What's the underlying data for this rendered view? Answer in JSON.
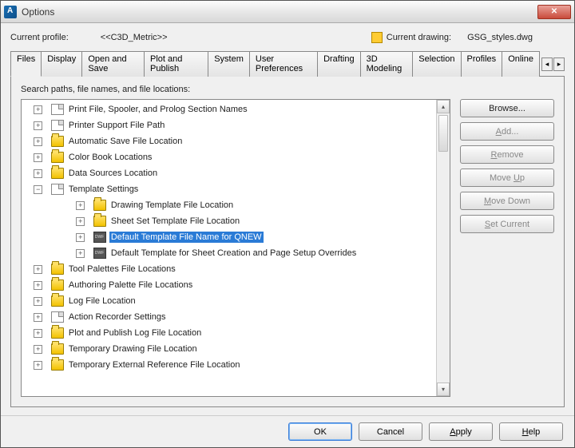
{
  "window": {
    "title": "Options"
  },
  "profile": {
    "label": "Current profile:",
    "value": "<<C3D_Metric>>",
    "drawing_label": "Current drawing:",
    "drawing_value": "GSG_styles.dwg"
  },
  "tabs": {
    "items": [
      "Files",
      "Display",
      "Open and Save",
      "Plot and Publish",
      "System",
      "User Preferences",
      "Drafting",
      "3D Modeling",
      "Selection",
      "Profiles",
      "Online"
    ],
    "active_index": 0
  },
  "panel": {
    "label": "Search paths, file names, and file locations:"
  },
  "tree": {
    "nodes": [
      {
        "indent": 0,
        "exp": "+",
        "icon": "doc",
        "label": "Print File, Spooler, and Prolog Section Names"
      },
      {
        "indent": 0,
        "exp": "+",
        "icon": "doc",
        "label": "Printer Support File Path"
      },
      {
        "indent": 0,
        "exp": "+",
        "icon": "folder",
        "label": "Automatic Save File Location"
      },
      {
        "indent": 0,
        "exp": "+",
        "icon": "folder",
        "label": "Color Book Locations"
      },
      {
        "indent": 0,
        "exp": "+",
        "icon": "folder",
        "label": "Data Sources Location"
      },
      {
        "indent": 0,
        "exp": "-",
        "icon": "doc",
        "label": "Template Settings"
      },
      {
        "indent": 1,
        "exp": "+",
        "icon": "folder",
        "label": "Drawing Template File Location"
      },
      {
        "indent": 1,
        "exp": "+",
        "icon": "folder",
        "label": "Sheet Set Template File Location"
      },
      {
        "indent": 1,
        "exp": "+",
        "icon": "dwf",
        "label": "Default Template File Name for QNEW",
        "selected": true
      },
      {
        "indent": 1,
        "exp": "+",
        "icon": "dwf",
        "label": "Default Template for Sheet Creation and Page Setup Overrides"
      },
      {
        "indent": 0,
        "exp": "+",
        "icon": "folder",
        "label": "Tool Palettes File Locations"
      },
      {
        "indent": 0,
        "exp": "+",
        "icon": "folder",
        "label": "Authoring Palette File Locations"
      },
      {
        "indent": 0,
        "exp": "+",
        "icon": "folder",
        "label": "Log File Location"
      },
      {
        "indent": 0,
        "exp": "+",
        "icon": "doc",
        "label": "Action Recorder Settings"
      },
      {
        "indent": 0,
        "exp": "+",
        "icon": "folder",
        "label": "Plot and Publish Log File Location"
      },
      {
        "indent": 0,
        "exp": "+",
        "icon": "folder",
        "label": "Temporary Drawing File Location"
      },
      {
        "indent": 0,
        "exp": "+",
        "icon": "folder",
        "label": "Temporary External Reference File Location"
      }
    ]
  },
  "side_buttons": {
    "browse": "Browse...",
    "add": "Add...",
    "remove": "Remove",
    "move_up": "Move Up",
    "move_down": "Move Down",
    "set_current": "Set Current"
  },
  "footer": {
    "ok": "OK",
    "cancel": "Cancel",
    "apply": "Apply",
    "help": "Help"
  }
}
